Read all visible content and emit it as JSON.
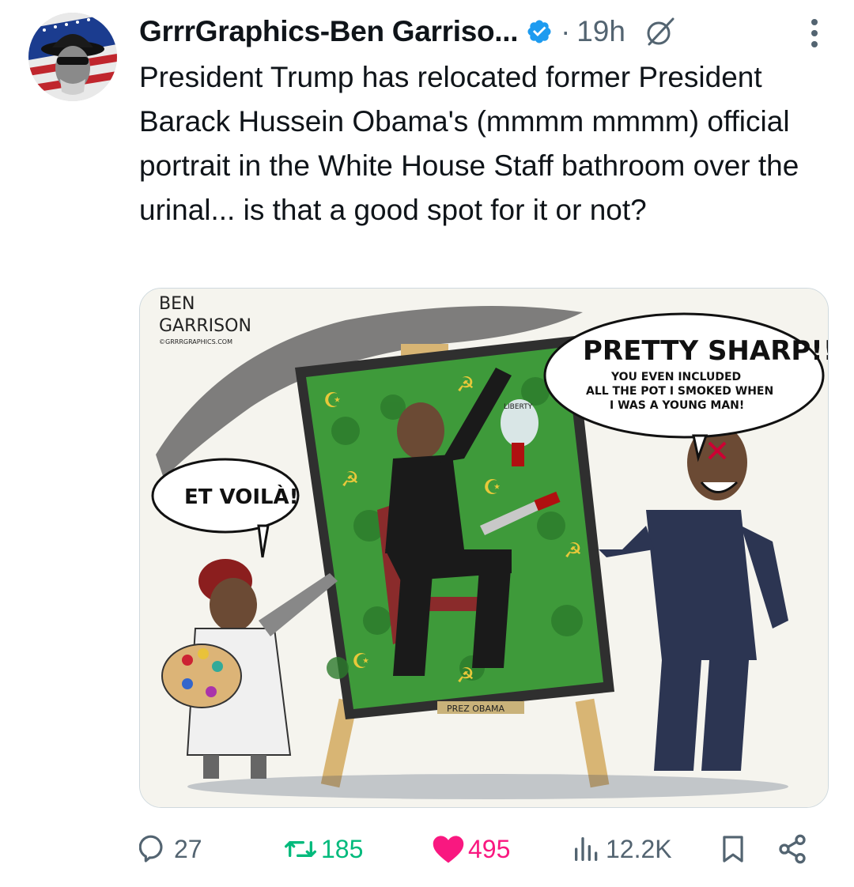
{
  "tweet": {
    "author_name": "GrrrGraphics-Ben Garriso...",
    "time": "19h",
    "body": "President Trump has relocated former President Barack Hussein Obama's (mmmm mmmm) official portrait in the White House Staff bathroom over the urinal... is that a good spot for it or not?"
  },
  "cartoon": {
    "signature_1": "BEN",
    "signature_2": "GARRISON",
    "signature_url": "©GRRRGRAPHICS.COM",
    "bubble_left": "ET VOILÀ!",
    "bubble_right_title": "PRETTY SHARP!!",
    "bubble_right_line1": "YOU EVEN INCLUDED",
    "bubble_right_line2": "ALL THE POT I SMOKED WHEN",
    "bubble_right_line3": "I WAS A YOUNG MAN!",
    "liberty_label": "LIBERTY",
    "frame_plaque": "PREZ OBAMA"
  },
  "actions": {
    "replies": "27",
    "reposts": "185",
    "likes": "495",
    "views": "12.2K"
  },
  "colors": {
    "verified": "#1d9bf0",
    "repost": "#00ba7c",
    "like": "#f91880",
    "secondary": "#536471"
  },
  "icons": [
    "verified-badge-icon",
    "grok-icon",
    "more-icon",
    "reply-icon",
    "repost-icon",
    "heart-icon",
    "views-icon",
    "bookmark-icon",
    "share-icon"
  ]
}
